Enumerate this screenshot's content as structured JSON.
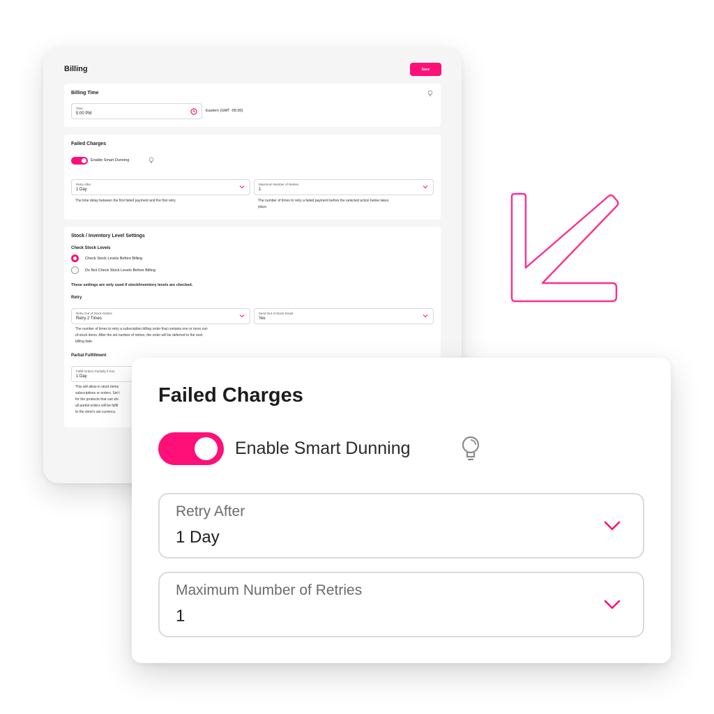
{
  "billing": {
    "title": "Billing",
    "save_label": "Save",
    "billing_time": {
      "heading": "Billing Time",
      "time_label": "Time",
      "time_value": "5:00 PM",
      "timezone": "Eastern (GMT -05:00)"
    },
    "failed_charges": {
      "heading": "Failed Charges",
      "toggle_label": "Enable Smart Dunning",
      "toggle_on": true,
      "retry_after_label": "Retry After",
      "retry_after_value": "1 Day",
      "retry_after_help": "The time delay between the first failed payment and the first retry.",
      "max_retries_label": "Maximum Number of Retries",
      "max_retries_value": "1",
      "max_retries_help_1": "The number of times to retry a failed payment before the selected action below takes",
      "max_retries_help_2": "place."
    },
    "stock": {
      "heading": "Stock / Inventory Level Settings",
      "check_heading": "Check Stock Levels",
      "option_check": "Check Stock Levels Before Billing",
      "option_no_check": "Do Not Check Stock Levels Before Billing",
      "settings_note": "These settings are only used if stock/inventory levels are checked.",
      "retry_heading": "Retry",
      "retry_oos_label": "Retry Out of Stock Orders",
      "retry_oos_value": "Retry 2 Times",
      "send_email_label": "Send Out of Stock Email",
      "send_email_value": "Yes",
      "retry_help_1": "The number of times to retry a subscription billing order that contains one or more out-",
      "retry_help_2": "of-stock items. After the set number of retries, the order will be deferred to the next",
      "retry_help_3": "billing date.",
      "partial_heading": "Partial Fulfillment",
      "partial_label": "Fulfill Orders Partially if Son",
      "partial_value": "1 Day",
      "partial_help_1": "This will allow in stock items",
      "partial_help_2": "subscriptions or orders. Set t",
      "partial_help_3": "for the products that can shi",
      "partial_help_4": "all partial orders will be fulfil",
      "partial_help_5": "to the store's set currency."
    }
  },
  "zoom": {
    "heading": "Failed Charges",
    "toggle_label": "Enable Smart Dunning",
    "retry_after_label": "Retry After",
    "retry_after_value": "1 Day",
    "max_retries_label": "Maximum Number of Retries",
    "max_retries_value": "1"
  },
  "icons": {
    "clock": "clock-icon",
    "bulb": "lightbulb-icon",
    "chevron": "chevron-down-icon",
    "arrow": "arrow-down-left-icon"
  },
  "colors": {
    "accent": "#ff0f78",
    "background": "#f5f5f6"
  }
}
